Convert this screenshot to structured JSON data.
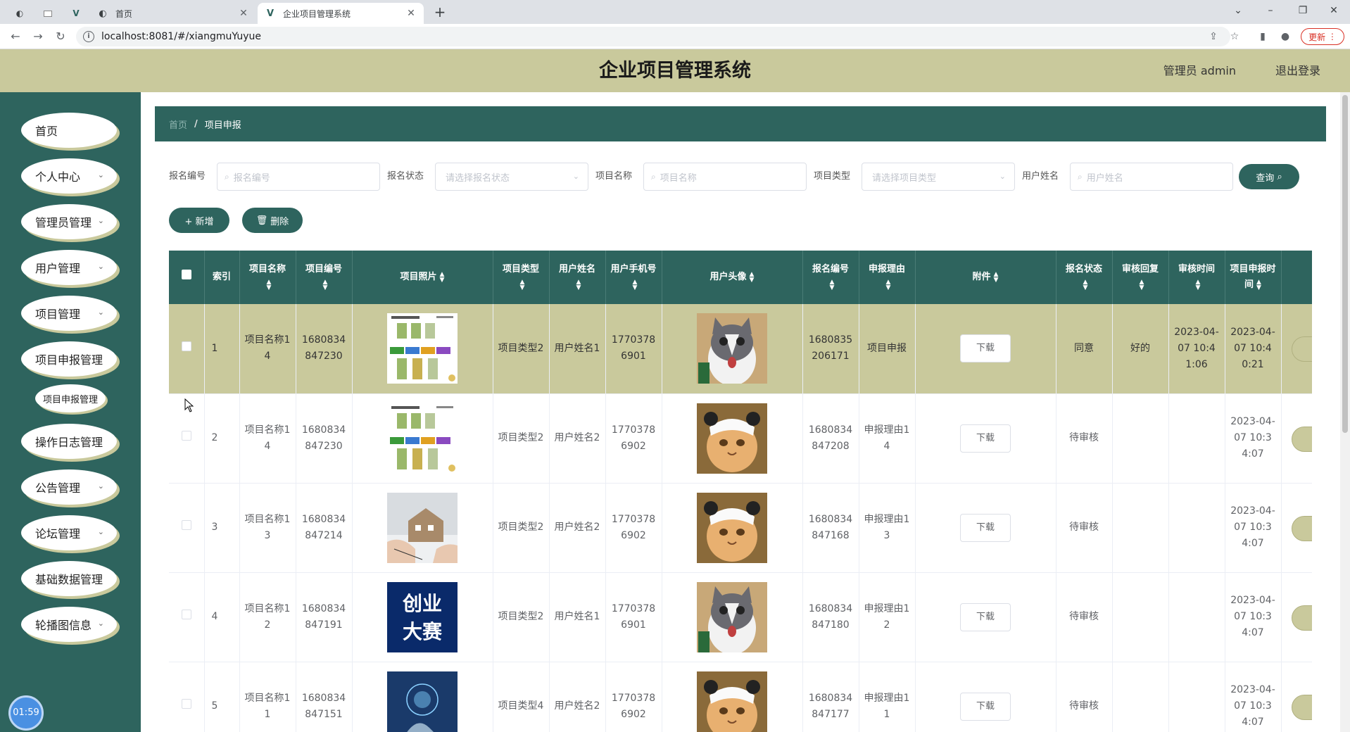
{
  "browser": {
    "tabs": [
      {
        "title": "首页",
        "icon": "globe-icon"
      },
      {
        "title": "企业项目管理系统",
        "icon": "vue-icon"
      }
    ],
    "url": "localhost:8081/#/xiangmuYuyue",
    "update_label": "更新"
  },
  "header": {
    "title": "企业项目管理系统",
    "user": "管理员 admin",
    "logout": "退出登录"
  },
  "sidebar": {
    "items": [
      {
        "label": "首页",
        "has_arrow": false
      },
      {
        "label": "个人中心",
        "has_arrow": true
      },
      {
        "label": "管理员管理",
        "has_arrow": true
      },
      {
        "label": "用户管理",
        "has_arrow": true
      },
      {
        "label": "项目管理",
        "has_arrow": true
      },
      {
        "label": "项目申报管理",
        "has_arrow": false
      },
      {
        "label": "操作日志管理",
        "has_arrow": false
      },
      {
        "label": "公告管理",
        "has_arrow": true
      },
      {
        "label": "论坛管理",
        "has_arrow": true
      },
      {
        "label": "基础数据管理",
        "has_arrow": false
      },
      {
        "label": "轮播图信息",
        "has_arrow": true
      }
    ],
    "submenu": "项目申报管理",
    "clock": "01:59"
  },
  "breadcrumb": {
    "home": "首页",
    "sep": "/",
    "current": "项目申报"
  },
  "search": {
    "labels": [
      "报名编号",
      "报名状态",
      "项目名称",
      "项目类型",
      "用户姓名"
    ],
    "placeholders": [
      "报名编号",
      "请选择报名状态",
      "项目名称",
      "请选择项目类型",
      "用户姓名"
    ],
    "query": "查询"
  },
  "actions": {
    "add": "+ 新增",
    "delete": "删除"
  },
  "table": {
    "headers": [
      "索引",
      "项目名称",
      "项目编号",
      "项目照片",
      "项目类型",
      "用户姓名",
      "用户手机号",
      "用户头像",
      "报名编号",
      "申报理由",
      "附件",
      "报名状态",
      "审核回复",
      "审核时间",
      "项目申报时间"
    ],
    "download": "下载",
    "rows": [
      {
        "idx": "1",
        "name": "项目名称14",
        "code": "1680834847230",
        "type": "项目类型2",
        "user": "用户姓名1",
        "phone": "17703786901",
        "reg": "1680835206171",
        "reason": "项目申报",
        "status": "同意",
        "reply": "好的",
        "audit_time": "2023-04-07 10:41:06",
        "time": "2023-04-07 10:40:21",
        "photo": "diagram",
        "avatar": "cat-gray"
      },
      {
        "idx": "2",
        "name": "项目名称14",
        "code": "1680834847230",
        "type": "项目类型2",
        "user": "用户姓名2",
        "phone": "17703786902",
        "reg": "1680834847208",
        "reason": "申报理由14",
        "status": "待审核",
        "reply": "",
        "audit_time": "",
        "time": "2023-04-07 10:34:07",
        "photo": "diagram",
        "avatar": "cat-orange"
      },
      {
        "idx": "3",
        "name": "项目名称13",
        "code": "1680834847214",
        "type": "项目类型2",
        "user": "用户姓名2",
        "phone": "17703786902",
        "reg": "1680834847168",
        "reason": "申报理由13",
        "status": "待审核",
        "reply": "",
        "audit_time": "",
        "time": "2023-04-07 10:34:07",
        "photo": "house",
        "avatar": "cat-orange"
      },
      {
        "idx": "4",
        "name": "项目名称12",
        "code": "1680834847191",
        "type": "项目类型2",
        "user": "用户姓名1",
        "phone": "17703786901",
        "reg": "1680834847180",
        "reason": "申报理由12",
        "status": "待审核",
        "reply": "",
        "audit_time": "",
        "time": "2023-04-07 10:34:07",
        "photo": "contest",
        "avatar": "cat-gray"
      },
      {
        "idx": "5",
        "name": "项目名称11",
        "code": "1680834847151",
        "type": "项目类型4",
        "user": "用户姓名2",
        "phone": "17703786902",
        "reg": "1680834847177",
        "reason": "申报理由11",
        "status": "待审核",
        "reply": "",
        "audit_time": "",
        "time": "2023-04-07 10:34:07",
        "photo": "tech",
        "avatar": "cat-orange"
      }
    ],
    "contest_text": [
      "创业",
      "大赛"
    ]
  },
  "colors": {
    "primary": "#2e645e",
    "accent": "#c9c99c"
  }
}
